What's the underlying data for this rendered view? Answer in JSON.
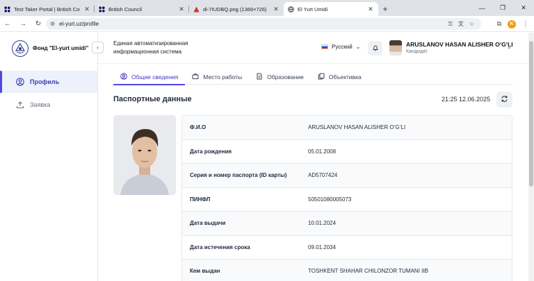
{
  "browser": {
    "tabs": [
      {
        "label": "Test Taker Portal | British Council",
        "icon": "british-council-icon",
        "active": false
      },
      {
        "label": "British Council",
        "icon": "british-council-icon",
        "active": false
      },
      {
        "label": "di-7IUDBQ.png (1366×726)",
        "icon": "image-file-icon",
        "active": false
      },
      {
        "label": "El Yurt Umidi",
        "icon": "globe-icon",
        "active": true
      }
    ],
    "url": "el-yurt.uz/profile",
    "profile_initial": "K"
  },
  "sidebar": {
    "logo_text": "Фонд \"El-yurt umidi\"",
    "items": [
      {
        "label": "Профиль",
        "icon": "user-circle-icon",
        "active": true
      },
      {
        "label": "Заявка",
        "icon": "upload-icon",
        "active": false
      }
    ]
  },
  "header": {
    "system_title": "Единая автоматизированная информационная система",
    "language": "Русский",
    "user_name": "ARUSLANOV HASAN ALISHER O‘G‘LI",
    "user_role": "Кандидат"
  },
  "page_tabs": [
    {
      "label": "Общие сведения",
      "icon": "user-circle-icon",
      "active": true
    },
    {
      "label": "Место работы",
      "icon": "briefcase-icon",
      "active": false
    },
    {
      "label": "Образование",
      "icon": "document-icon",
      "active": false
    },
    {
      "label": "Объективка",
      "icon": "copy-icon",
      "active": false
    }
  ],
  "section": {
    "title": "Паспортные данные",
    "timestamp": "21:25 12.06.2025"
  },
  "passport": [
    {
      "label": "Ф.И.О",
      "value": "ARUSLANOV HASAN ALISHER O‘G‘LI"
    },
    {
      "label": "Дата рождения",
      "value": "05.01.2008"
    },
    {
      "label": "Серия и номер паспорта (ID карты)",
      "value": "AD5707424"
    },
    {
      "label": "ПИНФЛ",
      "value": "50501080005073"
    },
    {
      "label": "Дата выдачи",
      "value": "10.01.2024"
    },
    {
      "label": "Дата истечения срока",
      "value": "09.01.2034"
    },
    {
      "label": "Кем выдан",
      "value": "TOSHKENT SHAHAR CHILONZOR TUMANI IIB"
    }
  ],
  "colors": {
    "accent": "#4f46e5",
    "active_nav_bg": "#eef0fb"
  }
}
